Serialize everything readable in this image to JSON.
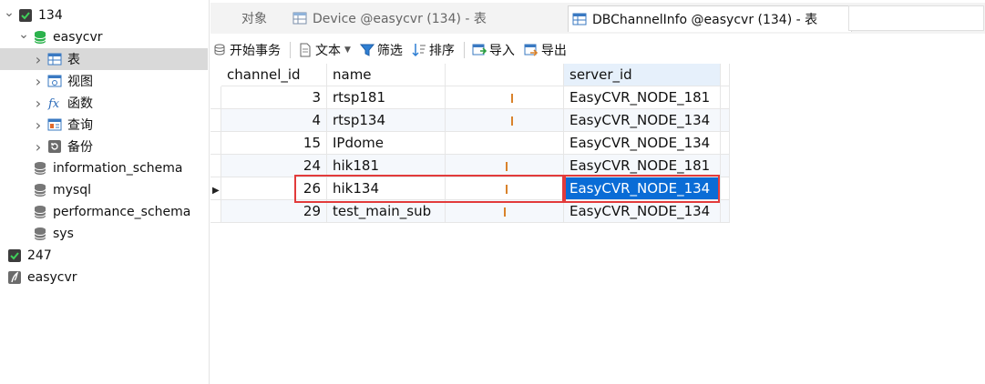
{
  "nav": {
    "items": [
      {
        "label": "134",
        "level": 0,
        "expand": "open",
        "icon": "connection-icon"
      },
      {
        "label": "easycvr",
        "level": 1,
        "expand": "open",
        "icon": "database-icon"
      },
      {
        "label": "表",
        "level": 2,
        "expand": "closed",
        "icon": "table-icon",
        "selected": true
      },
      {
        "label": "视图",
        "level": 2,
        "expand": "closed",
        "icon": "view-icon"
      },
      {
        "label": "函数",
        "level": 2,
        "expand": "closed",
        "icon": "function-icon"
      },
      {
        "label": "查询",
        "level": 2,
        "expand": "closed",
        "icon": "query-icon"
      },
      {
        "label": "备份",
        "level": 2,
        "expand": "closed",
        "icon": "backup-icon"
      },
      {
        "label": "information_schema",
        "level": 1,
        "expand": "none",
        "icon": "database-icon"
      },
      {
        "label": "mysql",
        "level": 1,
        "expand": "none",
        "icon": "database-icon"
      },
      {
        "label": "performance_schema",
        "level": 1,
        "expand": "none",
        "icon": "database-icon"
      },
      {
        "label": "sys",
        "level": 1,
        "expand": "none",
        "icon": "database-icon"
      },
      {
        "label": "247",
        "level": 0,
        "expand": "none",
        "icon": "connection-icon"
      },
      {
        "label": "easycvr",
        "level": 0,
        "expand": "none",
        "icon": "sqlite-icon"
      }
    ]
  },
  "tabs": [
    {
      "label": "对象",
      "active": false,
      "icon": ""
    },
    {
      "label": "Device @easycvr (134) - 表",
      "active": false,
      "icon": "table-icon"
    },
    {
      "label": "DBChannelInfo @easycvr (134) - 表",
      "active": true,
      "icon": "table-icon"
    }
  ],
  "toolbar": {
    "begin_tx": "开始事务",
    "text": "文本",
    "filter": "筛选",
    "sort": "排序",
    "import": "导入",
    "export": "导出"
  },
  "grid": {
    "columns": [
      "channel_id",
      "name",
      "server_id"
    ],
    "rows": [
      {
        "channel_id": "3",
        "name": "rtsp181",
        "server_id": "EasyCVR_NODE_181"
      },
      {
        "channel_id": "4",
        "name": "rtsp134",
        "server_id": "EasyCVR_NODE_134"
      },
      {
        "channel_id": "15",
        "name": "IPdome",
        "server_id": "EasyCVR_NODE_134"
      },
      {
        "channel_id": "24",
        "name": "hik181",
        "server_id": "EasyCVR_NODE_181"
      },
      {
        "channel_id": "26",
        "name": "hik134",
        "server_id": "EasyCVR_NODE_134"
      },
      {
        "channel_id": "29",
        "name": "test_main_sub",
        "server_id": "EasyCVR_NODE_134"
      }
    ],
    "current_row_index": 4,
    "selected_cell_color": "#0a6cd6",
    "highlight_color": "#e23b3b"
  }
}
